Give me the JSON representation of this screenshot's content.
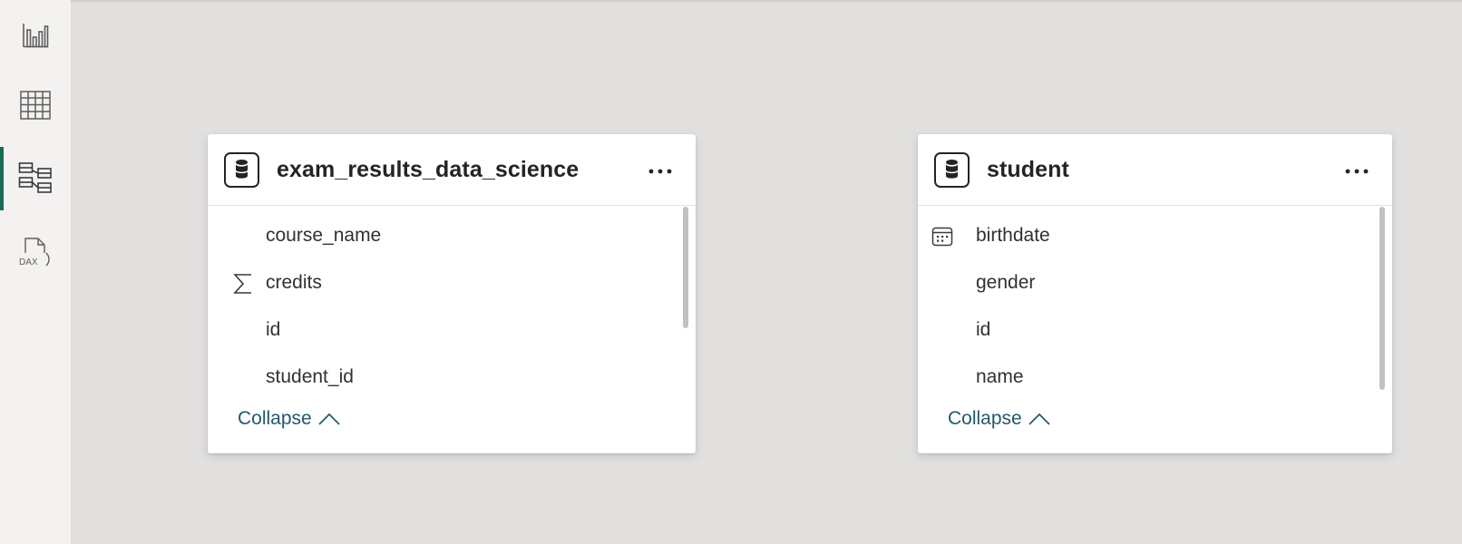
{
  "nav_rail": {
    "items": [
      {
        "icon": "report-view-icon",
        "active": false
      },
      {
        "icon": "table-view-icon",
        "active": false
      },
      {
        "icon": "model-view-icon",
        "active": true
      },
      {
        "icon": "dax-query-view-icon",
        "active": false,
        "icon_text": "DAX"
      }
    ]
  },
  "tables": [
    {
      "name": "exam_results_data_science",
      "menu_label": "···",
      "fields": [
        {
          "label": "course_name",
          "icon": ""
        },
        {
          "label": "credits",
          "icon": "sigma-icon"
        },
        {
          "label": "id",
          "icon": ""
        },
        {
          "label": "student_id",
          "icon": ""
        }
      ],
      "collapse_label": "Collapse"
    },
    {
      "name": "student",
      "menu_label": "···",
      "fields": [
        {
          "label": "birthdate",
          "icon": "calendar-icon"
        },
        {
          "label": "gender",
          "icon": ""
        },
        {
          "label": "id",
          "icon": ""
        },
        {
          "label": "name",
          "icon": ""
        }
      ],
      "collapse_label": "Collapse"
    }
  ],
  "colors": {
    "canvas": "#e1e0df",
    "rail": "#f3f2f1",
    "accent": "#1a6b54",
    "link": "#21596d"
  }
}
